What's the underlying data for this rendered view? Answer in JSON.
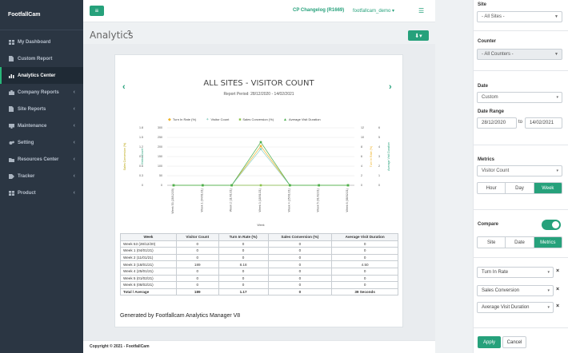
{
  "sidebar": {
    "brand": "FootfallCam",
    "items": [
      {
        "label": "My Dashboard",
        "icon": "dashboard-icon",
        "caret": false,
        "active": false
      },
      {
        "label": "Custom Report",
        "icon": "file-icon",
        "caret": false,
        "active": false
      },
      {
        "label": "Analytics Center",
        "icon": "bar-chart-icon",
        "caret": false,
        "active": true
      },
      {
        "label": "Company Reports",
        "icon": "briefcase-icon",
        "caret": true,
        "active": false
      },
      {
        "label": "Site Reports",
        "icon": "file-icon",
        "caret": true,
        "active": false
      },
      {
        "label": "Maintenance",
        "icon": "monitor-icon",
        "caret": true,
        "active": false
      },
      {
        "label": "Setting",
        "icon": "gears-icon",
        "caret": true,
        "active": false
      },
      {
        "label": "Resources Center",
        "icon": "folder-icon",
        "caret": true,
        "active": false
      },
      {
        "label": "Tracker",
        "icon": "tag-icon",
        "caret": true,
        "active": false
      },
      {
        "label": "Product",
        "icon": "grid-icon",
        "caret": true,
        "active": false
      }
    ]
  },
  "topbar": {
    "changelog": "CP Changelog (R1669)",
    "user": "footfallcam_demo",
    "user_caret": "▾"
  },
  "page": {
    "title": "Analytics",
    "help_glyph": "?",
    "export_glyph": "⬇▾"
  },
  "chart_data": {
    "type": "line",
    "title": "ALL SITES - VISITOR COUNT",
    "period": "Report Period: 28/12/2020 - 14/02/2021",
    "xlabel": "Week",
    "x": [
      "Week 53 (28/12/20)",
      "Week 1 (04/01/21)",
      "Week 2 (11/01/21)",
      "Week 3 (18/01/21)",
      "Week 4 (25/01/21)",
      "Week 5 (01/02/21)",
      "Week 6 (08/02/21)"
    ],
    "series": [
      {
        "name": "Turn In Rate (%)",
        "color": "#f0b429",
        "values": [
          0,
          0,
          0,
          8.18,
          0,
          0,
          0
        ],
        "axis": "right1"
      },
      {
        "name": "Visitor Count",
        "color": "#8fd0c4",
        "values": [
          0,
          0,
          0,
          189,
          0,
          0,
          0
        ],
        "axis": "left2"
      },
      {
        "name": "Sales Conversion (%)",
        "color": "#8bc34a",
        "values": [
          0,
          0,
          0,
          0,
          0,
          0,
          0
        ],
        "axis": "left1"
      },
      {
        "name": "Average Visit Duration",
        "color": "#4caf50",
        "values": [
          0,
          0,
          0,
          4.5,
          0,
          0,
          0
        ],
        "axis": "right2"
      }
    ],
    "axes": {
      "left1": {
        "label": "Sales Conversion (%)",
        "ticks": [
          "0",
          "0",
          "0",
          "0",
          "0",
          "0",
          "0",
          "0"
        ]
      },
      "left2": {
        "label": "Visitor Count",
        "ticks": [
          "0",
          "50",
          "100",
          "150",
          "200",
          "250",
          "300"
        ],
        "range": [
          0,
          300
        ]
      },
      "right1": {
        "label": "Turn In Rate (%)",
        "ticks": [
          "0",
          "2",
          "4",
          "6",
          "8",
          "10",
          "12"
        ],
        "range": [
          0,
          12
        ]
      },
      "right2": {
        "label": "Average Visit Duration",
        "ticks": [
          "0",
          "1",
          "2",
          "3",
          "4",
          "5",
          "6"
        ],
        "range": [
          0,
          6
        ]
      }
    },
    "left1_ticks_display": [
      "0",
      "0.3",
      "0.6",
      "0.9",
      "1.2",
      "1.5",
      "1.8",
      "2.1"
    ]
  },
  "table": {
    "headers": [
      "Week",
      "Visitor Count",
      "Turn In Rate (%)",
      "Sales Conversion (%)",
      "Average Visit Duration"
    ],
    "rows": [
      [
        "Week 53 (28/12/20)",
        "0",
        "0",
        "0",
        "0"
      ],
      [
        "Week 1 (04/01/21)",
        "0",
        "0",
        "0",
        "0"
      ],
      [
        "Week 2 (11/01/21)",
        "0",
        "0",
        "0",
        "0"
      ],
      [
        "Week 3 (18/01/21)",
        "189",
        "8.18",
        "0",
        "4.50"
      ],
      [
        "Week 4 (25/01/21)",
        "0",
        "0",
        "0",
        "0"
      ],
      [
        "Week 5 (01/02/21)",
        "0",
        "0",
        "0",
        "0"
      ],
      [
        "Week 6 (08/02/21)",
        "0",
        "0",
        "0",
        "0"
      ]
    ],
    "total": [
      "Total / Average",
      "189",
      "1.17",
      "0",
      "39 Seconds"
    ]
  },
  "generated": "Generated by Footfallcam Analytics Manager V8",
  "footer": "Copyright © 2021 - FootfallCam",
  "panel": {
    "site_label": "Site",
    "site_value": "- All Sites -",
    "counter_label": "Counter",
    "counter_value": "- All Counters -",
    "date_label": "Date",
    "date_value": "Custom",
    "range_label": "Date Range",
    "date_from": "28/12/2020",
    "to": "to",
    "date_to": "14/02/2021",
    "metrics_label": "Metrics",
    "metrics_value": "Visitor Count",
    "granularity": [
      "Hour",
      "Day",
      "Week"
    ],
    "compare_label": "Compare",
    "compare_modes": [
      "Site",
      "Date",
      "Metrics"
    ],
    "compare_metrics": [
      "Turn In Rate",
      "Sales Conversion",
      "Average Visit Duration"
    ],
    "apply": "Apply",
    "cancel": "Cancel"
  }
}
